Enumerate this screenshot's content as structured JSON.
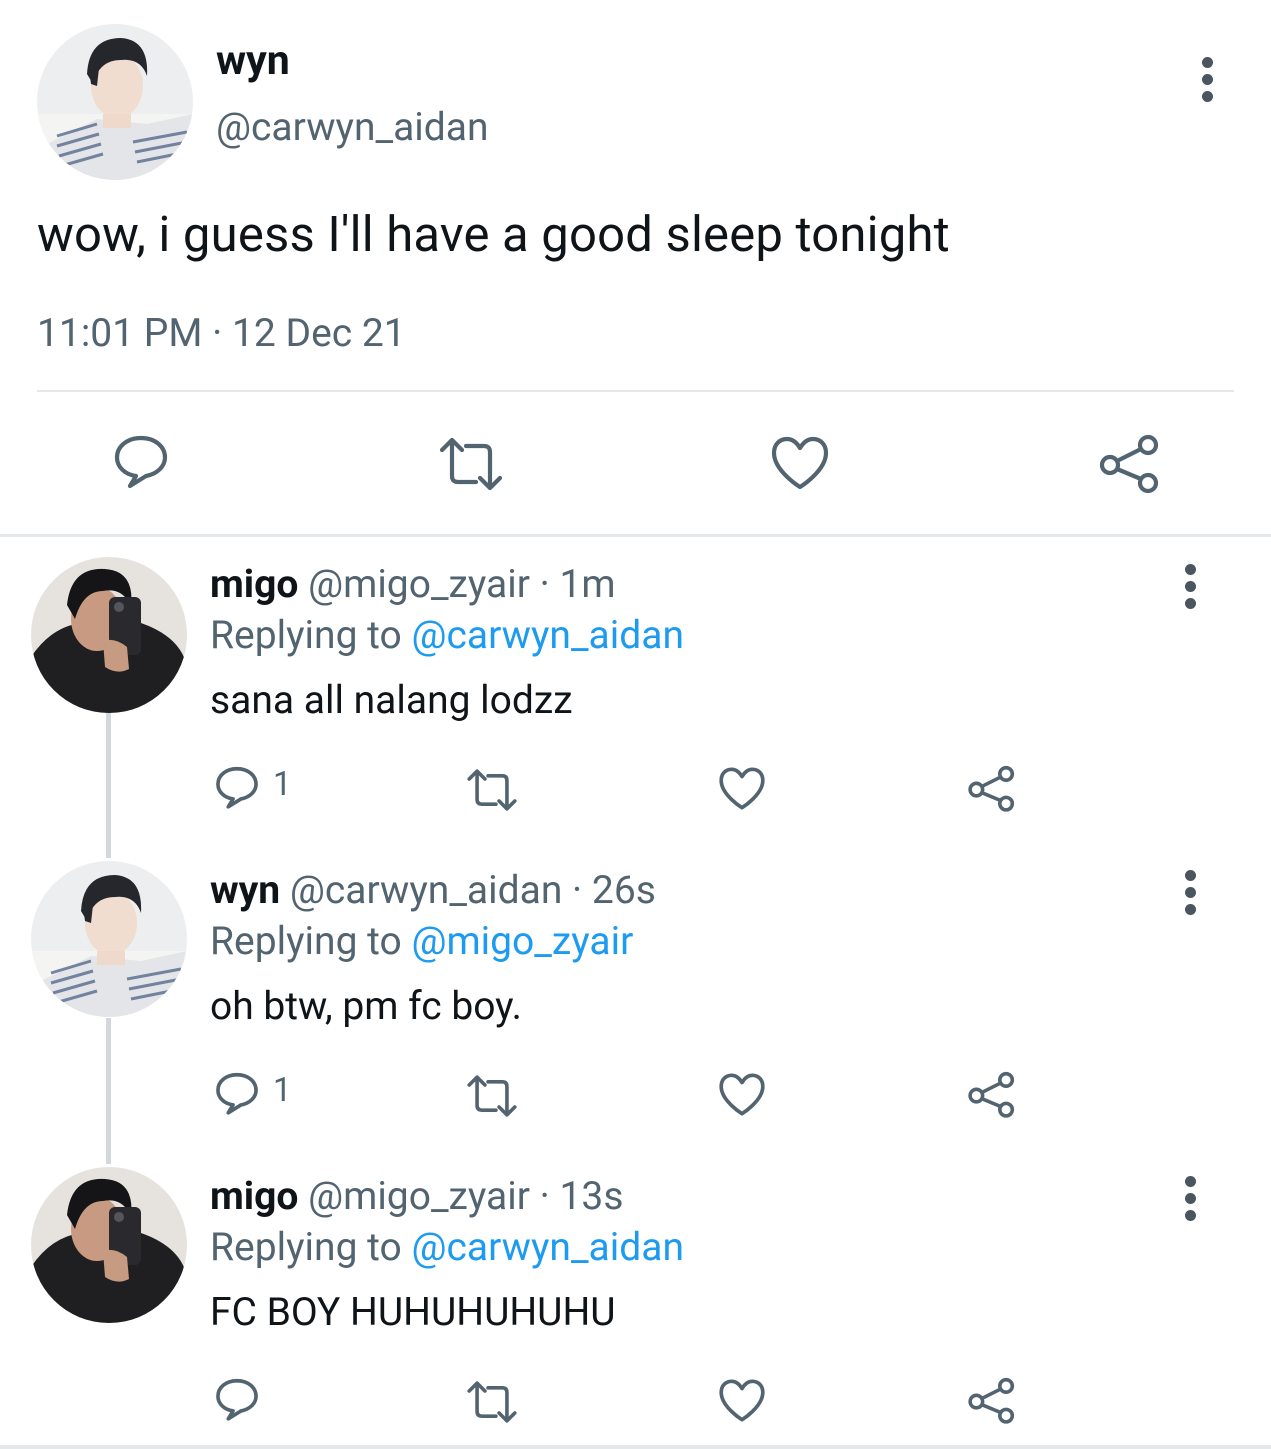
{
  "main_tweet": {
    "name": "wyn",
    "handle": "@carwyn_aidan",
    "text": "wow, i guess I'll have a good sleep tonight",
    "timestamp": "11:01 PM · 12 Dec 21",
    "actions": {
      "reply_icon": "reply-icon",
      "retweet_icon": "retweet-icon",
      "like_icon": "heart-icon",
      "share_icon": "share-icon"
    }
  },
  "replies": [
    {
      "name": "migo",
      "handle": "@migo_zyair",
      "time": "· 1m",
      "replying_prefix": "Replying to",
      "replying_to": "@carwyn_aidan",
      "text": "sana all nalang lodzz",
      "reply_count": "1"
    },
    {
      "name": "wyn",
      "handle": "@carwyn_aidan",
      "time": "· 26s",
      "replying_prefix": "Replying to",
      "replying_to": "@migo_zyair",
      "text": "oh btw, pm fc boy.",
      "reply_count": "1"
    },
    {
      "name": "migo",
      "handle": "@migo_zyair",
      "time": "· 13s",
      "replying_prefix": "Replying to",
      "replying_to": "@carwyn_aidan",
      "text": "FC BOY HUHUHUHUHU",
      "reply_count": ""
    }
  ],
  "colors": {
    "text_primary": "#0f1419",
    "text_secondary": "#536471",
    "mention": "#1d9bf0",
    "divider": "#e4e8eb"
  }
}
